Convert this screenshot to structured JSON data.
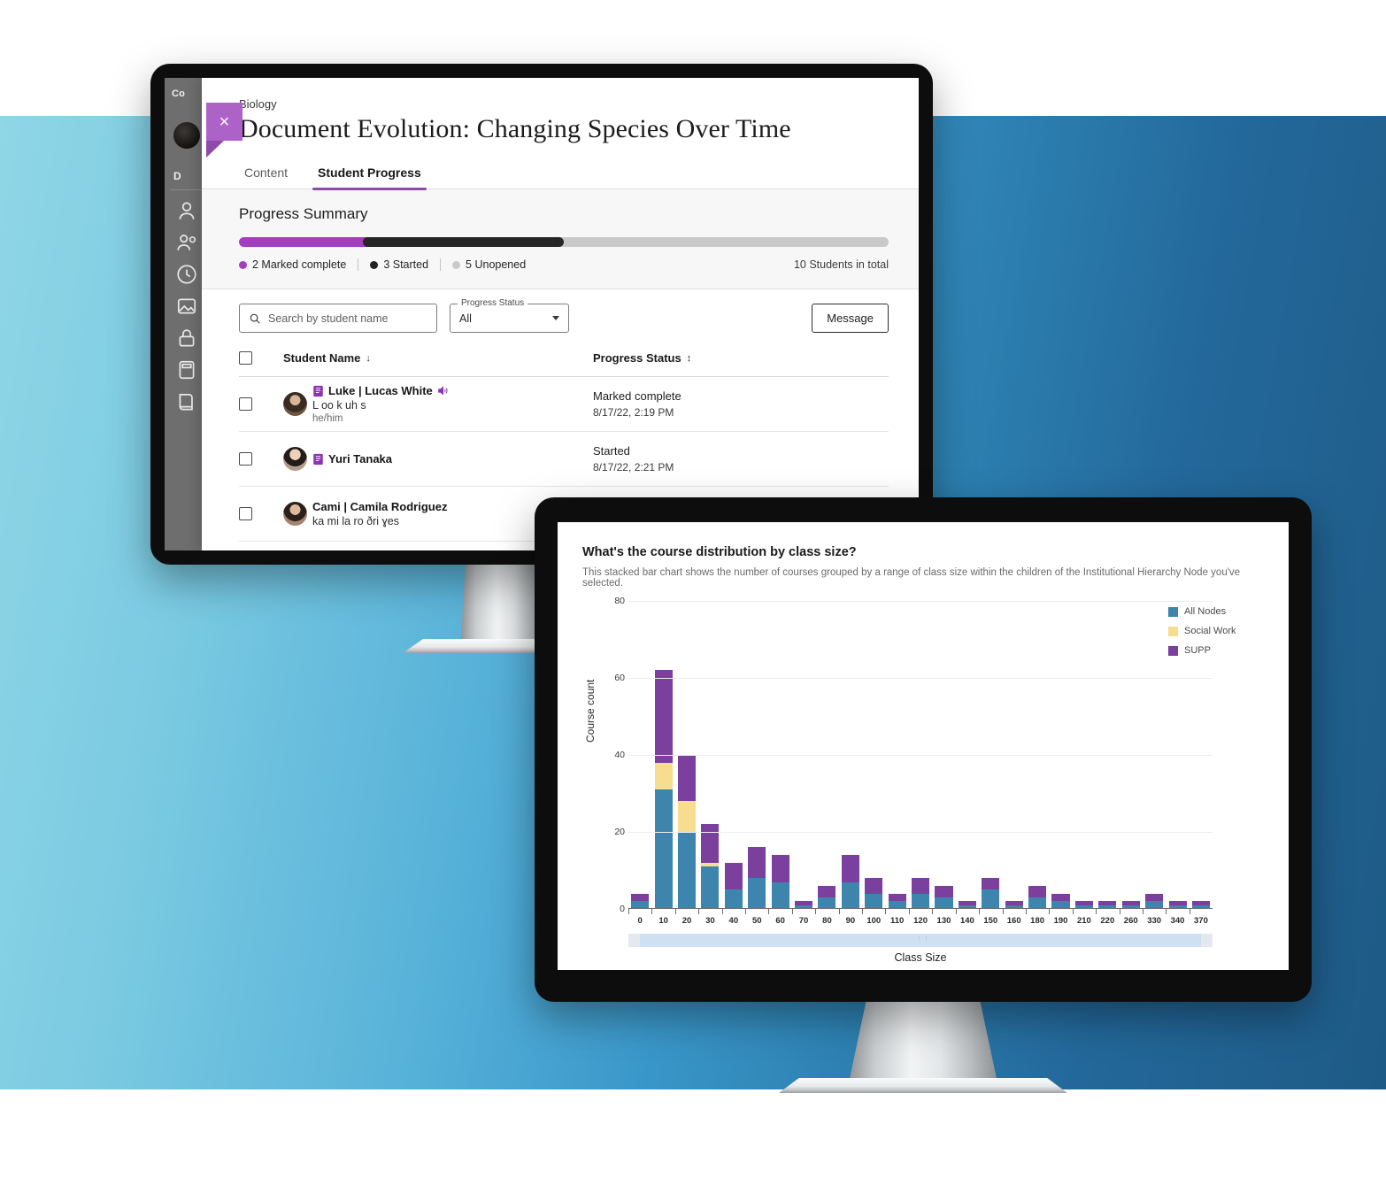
{
  "background": {
    "left_color": "#8fd6e6",
    "right_color": "#1e5a86"
  },
  "monitor_one": {
    "sidebar": {
      "title": "Co",
      "section_label": "D",
      "icons": [
        "person-icon",
        "people-group-icon",
        "clock-icon",
        "image-icon",
        "lock-icon",
        "calculator-icon",
        "book-icon"
      ]
    },
    "modal": {
      "close_label": "×",
      "breadcrumb": "Biology",
      "title": "Document Evolution: Changing Species Over Time",
      "tabs": [
        {
          "label": "Content",
          "active": false
        },
        {
          "label": "Student Progress",
          "active": true
        }
      ],
      "progress_summary": {
        "heading": "Progress Summary",
        "bar": {
          "complete_pct": 20,
          "started_pct": 30,
          "unopened_pct": 50,
          "complete_color": "#a23ec0",
          "started_color": "#262626",
          "unopened_color": "#c9c9c9"
        },
        "legend": [
          {
            "label": "2 Marked complete",
            "dot": "complete"
          },
          {
            "label": "3 Started",
            "dot": "started"
          },
          {
            "label": "5 Unopened",
            "dot": "unopened"
          }
        ],
        "total": "10 Students in total"
      },
      "toolbar": {
        "search_placeholder": "Search by student name",
        "search_value": "",
        "select_legend": "Progress Status",
        "select_value": "All",
        "select_options": [
          "All"
        ],
        "message_label": "Message"
      },
      "table": {
        "columns": [
          {
            "label": "Student Name",
            "sort": "↓"
          },
          {
            "label": "Progress Status",
            "sort": "↕"
          }
        ],
        "rows": [
          {
            "name": "Luke | Lucas White",
            "phonetic": "L oo k uh s",
            "pronouns": "he/him",
            "has_audio": true,
            "status": "Marked complete",
            "timestamp": "8/17/22, 2:19 PM",
            "avatar_class": "a1"
          },
          {
            "name": "Yuri Tanaka",
            "phonetic": "",
            "pronouns": "",
            "has_audio": false,
            "status": "Started",
            "timestamp": "8/17/22, 2:21 PM",
            "avatar_class": "a2"
          },
          {
            "name": "Cami | Camila Rodriguez",
            "phonetic": "ka mi la  ro ðri ɣes",
            "pronouns": "",
            "has_audio": false,
            "status": "",
            "timestamp": "",
            "avatar_class": "a3"
          }
        ]
      }
    }
  },
  "monitor_two": {
    "chart_title": "What's the course distribution by class size?",
    "chart_subtitle": "This stacked bar chart shows the number of courses grouped by a range of class size within the children of the Institutional Hierarchy Node you've selected.",
    "scrollbar": {
      "left_button": "◂",
      "right_button": "▸",
      "grip": "⋮⋮"
    }
  },
  "chart_data": {
    "type": "bar",
    "stacked": true,
    "title": "What's the course distribution by class size?",
    "subtitle": "This stacked bar chart shows the number of courses grouped by a range of class size within the children of the Institutional Hierarchy Node you've selected.",
    "xlabel": "Class Size",
    "ylabel": "Course count",
    "ylim": [
      0,
      80
    ],
    "yticks": [
      0,
      20,
      40,
      60,
      80
    ],
    "grid": true,
    "legend_position": "right",
    "categories": [
      "0",
      "10",
      "20",
      "30",
      "40",
      "50",
      "60",
      "70",
      "80",
      "90",
      "100",
      "110",
      "120",
      "130",
      "140",
      "150",
      "160",
      "180",
      "190",
      "210",
      "220",
      "260",
      "330",
      "340",
      "370"
    ],
    "series": [
      {
        "name": "All Nodes",
        "color": "#3d85ad",
        "values": [
          2,
          31,
          20,
          11,
          5,
          8,
          7,
          1,
          3,
          7,
          4,
          2,
          4,
          3,
          1,
          5,
          1,
          3,
          2,
          1,
          1,
          1,
          2,
          1,
          1
        ]
      },
      {
        "name": "Social Work",
        "color": "#f7dd8f",
        "values": [
          0,
          7,
          8,
          1,
          0,
          0,
          0,
          0,
          0,
          0,
          0,
          0,
          0,
          0,
          0,
          0,
          0,
          0,
          0,
          0,
          0,
          0,
          0,
          0,
          0
        ]
      },
      {
        "name": "SUPP",
        "color": "#7b3f9d",
        "values": [
          2,
          24,
          12,
          10,
          7,
          8,
          7,
          1,
          3,
          7,
          4,
          2,
          4,
          3,
          1,
          3,
          1,
          3,
          2,
          1,
          1,
          1,
          2,
          1,
          1
        ]
      }
    ],
    "totals": [
      4,
      62,
      40,
      22,
      12,
      16,
      14,
      2,
      6,
      14,
      8,
      4,
      8,
      6,
      2,
      8,
      2,
      6,
      4,
      2,
      2,
      2,
      4,
      2,
      2
    ]
  }
}
